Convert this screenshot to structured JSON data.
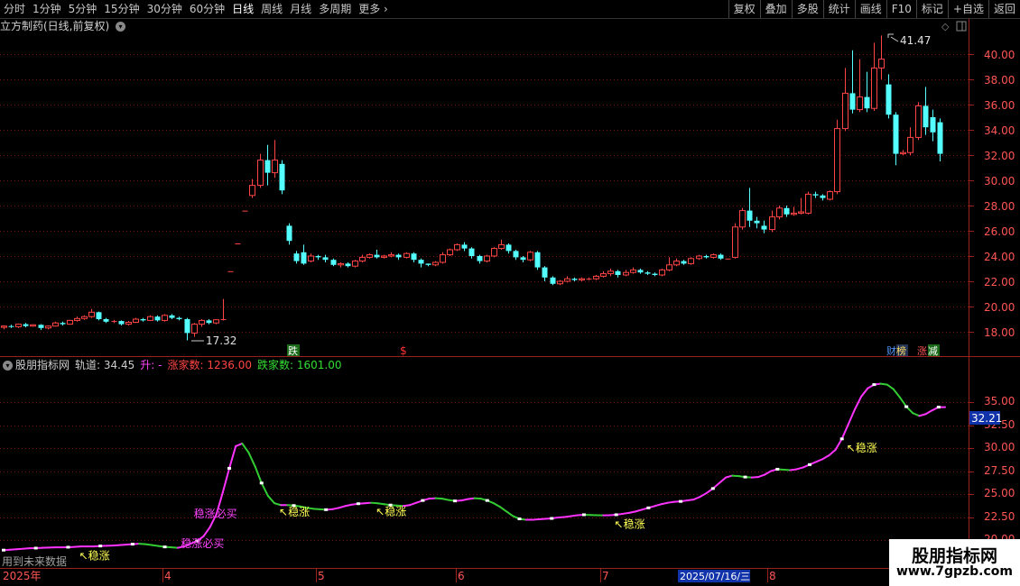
{
  "toolbar": {
    "periods": [
      "分时",
      "1分钟",
      "5分钟",
      "15分钟",
      "30分钟",
      "60分钟",
      "日线",
      "周线",
      "月线",
      "多周期",
      "更多"
    ],
    "active_period": "日线",
    "right_buttons": [
      "复权",
      "叠加",
      "多股",
      "统计",
      "画线",
      "F10",
      "标记",
      "+自选",
      "返回"
    ]
  },
  "main_chart": {
    "title": "立方制药(日线,前复权)",
    "y_ticks": [
      "40.00",
      "38.00",
      "36.00",
      "34.00",
      "32.00",
      "30.00",
      "28.00",
      "26.00",
      "24.00",
      "22.00",
      "20.00",
      "18.00"
    ],
    "high_label": "41.47",
    "low_label": "17.32",
    "markers": {
      "die": "跌",
      "dollar": "$",
      "cai": "财",
      "bang": "榜",
      "zhang": "涨",
      "jian": "减"
    }
  },
  "indicator": {
    "name": "股朋指标网",
    "guidao_label": "轨道:",
    "guidao_value": "34.45",
    "sheng_label": "升:",
    "sheng_value": "-",
    "zhangjia_label": "涨家数:",
    "zhangjia_value": "1236.00",
    "diejia_label": "跌家数:",
    "diejia_value": "1601.00",
    "y_ticks": [
      "35.00",
      "32.50",
      "30.00",
      "27.50",
      "25.00",
      "22.50",
      "20.00"
    ],
    "current_value": "32.21",
    "signal_wenzhang": "稳涨",
    "signal_bimai": "稳涨必买",
    "future_data": "用到未来数据"
  },
  "time_axis": {
    "labels": [
      "2025年",
      "4",
      "5",
      "6",
      "7",
      "8"
    ],
    "cursor_date": "2025/07/16/三"
  },
  "watermark": {
    "line1": "股朋指标网",
    "line2": "www.7gpzb.com"
  },
  "colors": {
    "up": "#ff4444",
    "down": "#54ffff",
    "grid": "#7a1010",
    "axis": "#9a2020",
    "curve_up": "#ff33ff",
    "curve_down": "#33cc33",
    "signal": "#ffff55"
  },
  "chart_data": {
    "type": "candlestick",
    "ylim": [
      16.5,
      42.0
    ],
    "candles": [
      [
        18.35,
        18.45,
        18.2,
        18.5
      ],
      [
        18.45,
        18.4,
        18.3,
        18.55
      ],
      [
        18.4,
        18.6,
        18.3,
        18.65
      ],
      [
        18.6,
        18.45,
        18.35,
        18.7
      ],
      [
        18.45,
        18.55,
        18.4,
        18.6
      ],
      [
        18.55,
        18.3,
        18.15,
        18.6
      ],
      [
        18.3,
        18.45,
        18.2,
        18.5
      ],
      [
        18.45,
        18.7,
        18.4,
        18.8
      ],
      [
        18.7,
        18.6,
        18.5,
        18.8
      ],
      [
        18.6,
        18.9,
        18.55,
        18.95
      ],
      [
        18.9,
        19.05,
        18.8,
        19.2
      ],
      [
        19.05,
        19.2,
        18.95,
        19.3
      ],
      [
        19.2,
        19.55,
        19.1,
        19.8
      ],
      [
        19.55,
        19.0,
        18.9,
        19.6
      ],
      [
        19.0,
        18.8,
        18.7,
        19.1
      ],
      [
        18.8,
        18.85,
        18.7,
        18.95
      ],
      [
        18.85,
        18.6,
        18.5,
        18.9
      ],
      [
        18.6,
        18.75,
        18.5,
        18.85
      ],
      [
        18.75,
        19.0,
        18.7,
        19.1
      ],
      [
        19.0,
        18.9,
        18.8,
        19.1
      ],
      [
        18.9,
        19.2,
        18.85,
        19.3
      ],
      [
        19.2,
        18.9,
        18.8,
        19.3
      ],
      [
        18.9,
        19.3,
        18.8,
        19.4
      ],
      [
        19.3,
        19.1,
        19.0,
        19.4
      ],
      [
        19.1,
        19.0,
        18.9,
        19.2
      ],
      [
        19.0,
        17.9,
        17.32,
        19.1
      ],
      [
        17.9,
        18.6,
        17.6,
        18.7
      ],
      [
        18.6,
        18.9,
        18.4,
        19.0
      ],
      [
        18.9,
        18.7,
        18.6,
        19.0
      ],
      [
        18.7,
        18.95,
        18.6,
        19.0
      ],
      [
        18.95,
        19.0,
        18.9,
        20.6
      ],
      [
        22.8,
        22.8,
        22.8,
        22.8
      ],
      [
        25.0,
        25.0,
        25.0,
        25.0
      ],
      [
        27.6,
        27.6,
        27.6,
        27.6
      ],
      [
        28.8,
        29.6,
        28.6,
        30.1
      ],
      [
        29.6,
        31.6,
        29.4,
        32.1
      ],
      [
        31.6,
        30.6,
        29.6,
        32.8
      ],
      [
        30.6,
        31.6,
        30.2,
        33.2
      ],
      [
        31.3,
        29.2,
        28.9,
        31.6
      ],
      [
        26.4,
        25.2,
        24.9,
        26.6
      ],
      [
        24.2,
        23.6,
        23.4,
        24.4
      ],
      [
        24.3,
        23.4,
        23.3,
        24.9
      ],
      [
        23.6,
        24.0,
        23.5,
        24.2
      ],
      [
        24.0,
        23.9,
        23.7,
        24.1
      ],
      [
        23.9,
        23.7,
        23.5,
        24.1
      ],
      [
        23.7,
        23.3,
        23.2,
        23.8
      ],
      [
        23.3,
        23.4,
        23.1,
        23.5
      ],
      [
        23.4,
        23.2,
        23.1,
        23.5
      ],
      [
        23.2,
        23.6,
        23.1,
        23.7
      ],
      [
        23.6,
        23.9,
        23.5,
        24.1
      ],
      [
        23.9,
        24.1,
        23.8,
        24.2
      ],
      [
        24.1,
        23.9,
        23.8,
        24.5
      ],
      [
        23.9,
        24.0,
        23.8,
        24.1
      ],
      [
        24.0,
        24.1,
        23.9,
        24.3
      ],
      [
        24.1,
        23.9,
        23.7,
        24.2
      ],
      [
        23.9,
        24.2,
        23.8,
        24.3
      ],
      [
        24.2,
        23.7,
        23.5,
        24.3
      ],
      [
        23.7,
        23.4,
        23.1,
        23.8
      ],
      [
        23.4,
        23.3,
        23.2,
        23.4
      ],
      [
        23.3,
        23.5,
        23.2,
        23.6
      ],
      [
        23.5,
        24.1,
        23.4,
        24.3
      ],
      [
        24.1,
        24.5,
        24.0,
        24.6
      ],
      [
        24.5,
        24.9,
        24.4,
        25.0
      ],
      [
        24.9,
        24.6,
        24.4,
        25.1
      ],
      [
        24.6,
        24.0,
        23.8,
        24.7
      ],
      [
        24.0,
        23.6,
        23.4,
        24.1
      ],
      [
        23.6,
        24.0,
        23.5,
        24.1
      ],
      [
        24.0,
        24.6,
        23.9,
        24.7
      ],
      [
        24.6,
        24.9,
        24.5,
        25.3
      ],
      [
        24.9,
        24.4,
        24.2,
        25.0
      ],
      [
        24.4,
        23.9,
        23.7,
        24.5
      ],
      [
        23.9,
        23.7,
        23.5,
        24.0
      ],
      [
        23.7,
        24.3,
        23.6,
        24.4
      ],
      [
        24.3,
        23.1,
        22.9,
        24.4
      ],
      [
        23.1,
        22.3,
        22.0,
        23.2
      ],
      [
        22.3,
        21.8,
        21.7,
        22.4
      ],
      [
        21.8,
        22.0,
        21.7,
        22.1
      ],
      [
        22.0,
        22.2,
        21.9,
        22.4
      ],
      [
        22.2,
        22.1,
        22.0,
        22.3
      ],
      [
        22.1,
        22.2,
        22.0,
        22.3
      ],
      [
        22.2,
        22.2,
        22.1,
        22.3
      ],
      [
        22.2,
        22.4,
        22.1,
        22.5
      ],
      [
        22.4,
        22.6,
        22.3,
        22.8
      ],
      [
        22.6,
        22.8,
        22.4,
        23.0
      ],
      [
        22.8,
        22.5,
        22.3,
        22.9
      ],
      [
        22.5,
        22.7,
        22.4,
        22.9
      ],
      [
        22.7,
        22.9,
        22.6,
        23.1
      ],
      [
        22.9,
        22.7,
        22.6,
        23.0
      ],
      [
        22.7,
        22.6,
        22.5,
        22.8
      ],
      [
        22.6,
        22.5,
        22.4,
        22.7
      ],
      [
        22.5,
        22.9,
        22.4,
        23.0
      ],
      [
        22.9,
        23.3,
        22.8,
        23.9
      ],
      [
        23.3,
        23.6,
        23.2,
        23.8
      ],
      [
        23.6,
        23.4,
        23.3,
        23.7
      ],
      [
        23.4,
        23.8,
        23.3,
        23.9
      ],
      [
        23.8,
        24.0,
        23.7,
        24.1
      ],
      [
        24.0,
        23.9,
        23.8,
        24.1
      ],
      [
        23.9,
        24.1,
        23.8,
        24.2
      ],
      [
        24.1,
        23.8,
        23.7,
        24.2
      ],
      [
        23.8,
        23.8,
        23.8,
        23.8
      ],
      [
        23.9,
        26.3,
        23.8,
        26.6
      ],
      [
        26.3,
        27.6,
        26.1,
        27.8
      ],
      [
        27.6,
        26.8,
        26.3,
        29.4
      ],
      [
        26.8,
        26.6,
        26.2,
        27.1
      ],
      [
        26.4,
        26.1,
        25.8,
        26.8
      ],
      [
        26.1,
        27.1,
        25.9,
        27.6
      ],
      [
        27.1,
        27.8,
        26.9,
        28.0
      ],
      [
        27.8,
        27.3,
        27.1,
        28.0
      ],
      [
        27.3,
        27.4,
        27.2,
        27.9
      ],
      [
        27.4,
        27.5,
        27.3,
        28.6
      ],
      [
        27.4,
        28.9,
        27.3,
        29.1
      ],
      [
        28.9,
        28.8,
        28.6,
        29.1
      ],
      [
        28.8,
        28.6,
        28.4,
        28.9
      ],
      [
        28.5,
        29.1,
        28.4,
        29.2
      ],
      [
        29.1,
        34.1,
        28.9,
        34.8
      ],
      [
        34.1,
        36.9,
        33.9,
        38.9
      ],
      [
        36.9,
        35.6,
        35.3,
        40.3
      ],
      [
        35.6,
        36.6,
        35.4,
        39.6
      ],
      [
        36.6,
        35.7,
        35.4,
        38.6
      ],
      [
        35.7,
        38.9,
        35.5,
        40.9
      ],
      [
        38.9,
        39.6,
        38.0,
        41.47
      ],
      [
        37.6,
        35.2,
        34.9,
        38.4
      ],
      [
        35.2,
        32.1,
        31.2,
        35.4
      ],
      [
        32.1,
        32.2,
        32.0,
        32.4
      ],
      [
        32.2,
        33.4,
        32.0,
        34.2
      ],
      [
        33.4,
        35.9,
        33.2,
        36.2
      ],
      [
        35.9,
        34.2,
        33.6,
        37.4
      ],
      [
        35.0,
        33.8,
        33.1,
        35.6
      ],
      [
        34.6,
        32.1,
        31.5,
        34.9
      ]
    ],
    "indicator_series": [
      18.9,
      18.95,
      19.0,
      19.05,
      19.1,
      19.12,
      19.15,
      19.18,
      19.2,
      19.2,
      19.22,
      19.25,
      19.3,
      19.3,
      19.3,
      19.35,
      19.38,
      19.4,
      19.45,
      19.5,
      19.55,
      19.6,
      19.55,
      19.45,
      19.35,
      19.25,
      19.2,
      19.15,
      19.3,
      19.6,
      19.9,
      20.4,
      21.4,
      22.8,
      25.2,
      27.8,
      30.2,
      30.5,
      29.5,
      28.0,
      26.2,
      24.8,
      24.0,
      23.8,
      23.8,
      23.75,
      23.65,
      23.5,
      23.4,
      23.35,
      23.3,
      23.35,
      23.5,
      23.7,
      23.85,
      23.95,
      24.0,
      24.05,
      24.0,
      23.9,
      23.8,
      23.75,
      23.7,
      23.8,
      24.05,
      24.3,
      24.5,
      24.55,
      24.5,
      24.35,
      24.25,
      24.3,
      24.45,
      24.55,
      24.5,
      24.3,
      24.0,
      23.6,
      23.1,
      22.6,
      22.3,
      22.2,
      22.2,
      22.25,
      22.3,
      22.35,
      22.45,
      22.5,
      22.6,
      22.7,
      22.75,
      22.72,
      22.7,
      22.68,
      22.7,
      22.75,
      22.85,
      22.95,
      23.1,
      23.3,
      23.5,
      23.7,
      23.9,
      24.05,
      24.15,
      24.2,
      24.3,
      24.4,
      24.7,
      25.1,
      25.6,
      26.2,
      26.8,
      27.0,
      26.95,
      26.85,
      26.8,
      26.85,
      27.1,
      27.5,
      27.7,
      27.65,
      27.6,
      27.7,
      27.9,
      28.2,
      28.5,
      28.8,
      29.2,
      29.8,
      31.0,
      32.6,
      34.2,
      35.6,
      36.5,
      36.9,
      37.0,
      36.9,
      36.4,
      35.5,
      34.5,
      33.8,
      33.5,
      33.7,
      34.1,
      34.45,
      34.45
    ],
    "indicator_ylim": [
      18.5,
      38.5
    ],
    "signals_wenzhang": [
      11,
      42,
      57,
      94,
      130
    ],
    "signals_bimai": [
      30,
      32
    ]
  }
}
